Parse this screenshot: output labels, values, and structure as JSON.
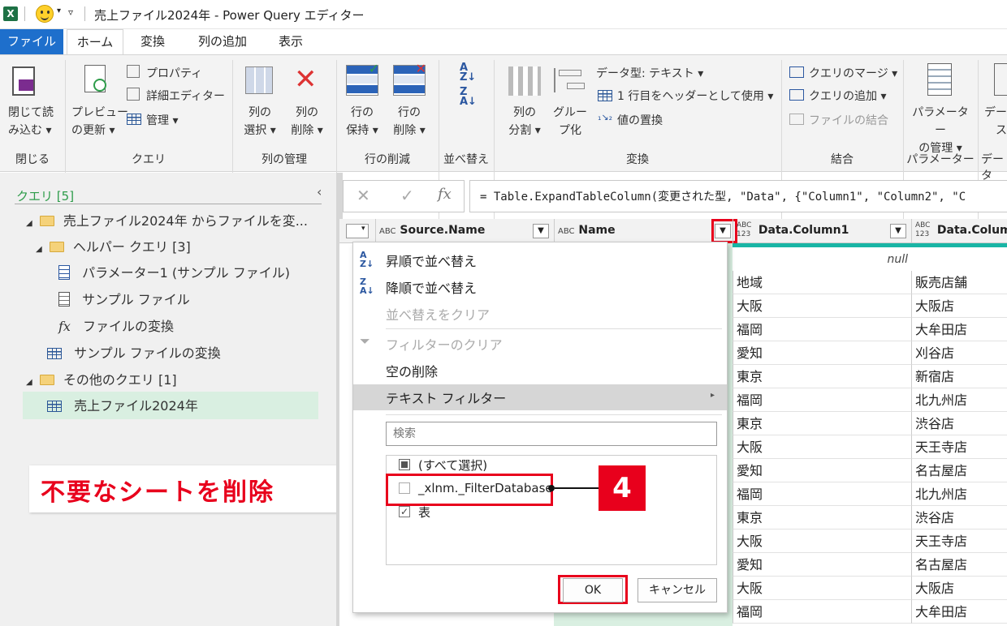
{
  "titlebar": {
    "title": "売上ファイル2024年 - Power Query エディター",
    "excel_icon": "X"
  },
  "tabs": [
    "ファイル",
    "ホーム",
    "変換",
    "列の追加",
    "表示"
  ],
  "ribbon": {
    "close_load": [
      "閉じて読",
      "み込む ▾"
    ],
    "preview": [
      "プレビュー",
      "の更新 ▾"
    ],
    "properties": "プロパティ",
    "advanced_editor": "詳細エディター",
    "manage": "管理 ▾",
    "select_cols": [
      "列の",
      "選択 ▾"
    ],
    "remove_cols": [
      "列の",
      "削除 ▾"
    ],
    "keep_rows": [
      "行の",
      "保持 ▾"
    ],
    "remove_rows": [
      "行の",
      "削除 ▾"
    ],
    "split_col": [
      "列の",
      "分割 ▾"
    ],
    "group_by": [
      "グルー",
      "プ化"
    ],
    "data_type": "データ型: テキスト ▾",
    "first_row_header": "1 行目をヘッダーとして使用 ▾",
    "replace_values": "値の置換",
    "merge_queries": "クエリのマージ ▾",
    "append_queries": "クエリの追加 ▾",
    "combine_files": "ファイルの結合",
    "manage_params": [
      "パラメーター",
      "の管理 ▾"
    ],
    "data_partial": [
      "デー",
      "ス"
    ],
    "groups": [
      "閉じる",
      "クエリ",
      "列の管理",
      "行の削減",
      "並べ替え",
      "変換",
      "結合",
      "パラメーター",
      "データ"
    ]
  },
  "queries": {
    "header": "クエリ",
    "count": "[5]",
    "items": [
      {
        "label": "売上ファイル2024年 からファイルを変..."
      },
      {
        "label": "ヘルパー クエリ",
        "count": "[3]"
      },
      {
        "label": "パラメーター1 (サンプル ファイル)"
      },
      {
        "label": "サンプル ファイル"
      },
      {
        "label": "ファイルの変換"
      },
      {
        "label": "サンプル ファイルの変換"
      },
      {
        "label": "その他のクエリ",
        "count": "[1]"
      },
      {
        "label": "売上ファイル2024年"
      }
    ]
  },
  "formula": "= Table.ExpandTableColumn(変更された型, \"Data\", {\"Column1\", \"Column2\", \"C",
  "grid": {
    "columns": [
      {
        "type": "ABC",
        "name": "Source.Name"
      },
      {
        "type": "ABC",
        "name": "Name"
      },
      {
        "type": "ABC 123",
        "name": "Data.Column1"
      },
      {
        "type": "ABC 123",
        "name": "Data.Colum"
      }
    ],
    "null_text": "null",
    "col1": [
      "地域",
      "大阪",
      "福岡",
      "愛知",
      "東京",
      "福岡",
      "東京",
      "大阪",
      "愛知",
      "福岡",
      "東京",
      "大阪",
      "愛知",
      "大阪",
      "福岡"
    ],
    "col2": [
      "販売店舗",
      "大阪店",
      "大牟田店",
      "刈谷店",
      "新宿店",
      "北九州店",
      "渋谷店",
      "天王寺店",
      "名古屋店",
      "北九州店",
      "渋谷店",
      "天王寺店",
      "名古屋店",
      "大阪店",
      "大牟田店"
    ]
  },
  "dropdown": {
    "sort_asc": "昇順で並べ替え",
    "sort_desc": "降順で並べ替え",
    "clear_sort": "並べ替えをクリア",
    "clear_filter": "フィルターのクリア",
    "remove_empty": "空の削除",
    "text_filter": "テキスト フィルター",
    "search_placeholder": "検索",
    "select_all": "(すべて選択)",
    "options": [
      {
        "label": "_xlnm._FilterDatabase",
        "checked": false
      },
      {
        "label": "表",
        "checked": true
      }
    ],
    "ok": "OK",
    "cancel": "キャンセル"
  },
  "annotation": {
    "text": "不要なシートを削除",
    "step": "4"
  },
  "colors": {
    "accent": "#1e6fcc",
    "highlight": "#e8001c",
    "selected_row": "#d9efe1",
    "teal": "#19b5a5"
  }
}
